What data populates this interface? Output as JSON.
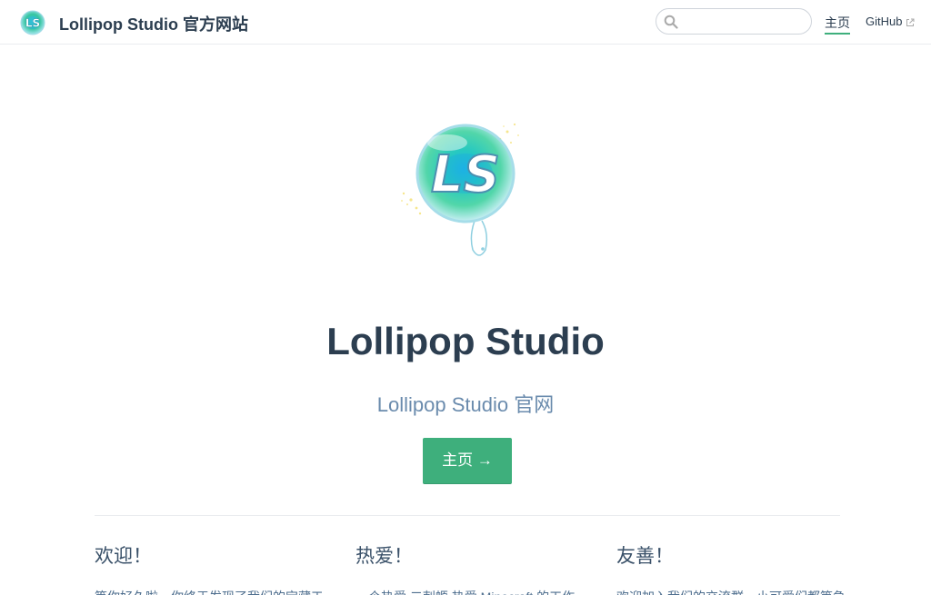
{
  "navbar": {
    "site_name": "Lollipop Studio 官方网站",
    "search": {
      "value": "",
      "placeholder": ""
    },
    "links": [
      {
        "label": "主页",
        "active": true
      },
      {
        "label": "GitHub",
        "external": true
      }
    ]
  },
  "hero": {
    "logo_text": "LS",
    "title": "Lollipop Studio",
    "description": "Lollipop Studio 官网",
    "action_label": "主页 →"
  },
  "features": [
    {
      "title": "欢迎！",
      "details": "等你好久啦，你终于发现了我们的宝藏工"
    },
    {
      "title": "热爱！",
      "details": "一个热爱 二刺螈 热爱 Minecraft 的工作"
    },
    {
      "title": "友善！",
      "details": "欢迎加入我们的交流群，小可爱们都等急"
    }
  ],
  "colors": {
    "accent": "#3eaf7c",
    "text": "#2c3e50",
    "description": "#6a8bad",
    "border": "#eaecef"
  },
  "icons": {
    "logo": "lollipop-ls-icon",
    "search": "search-icon",
    "external": "external-link-icon"
  }
}
